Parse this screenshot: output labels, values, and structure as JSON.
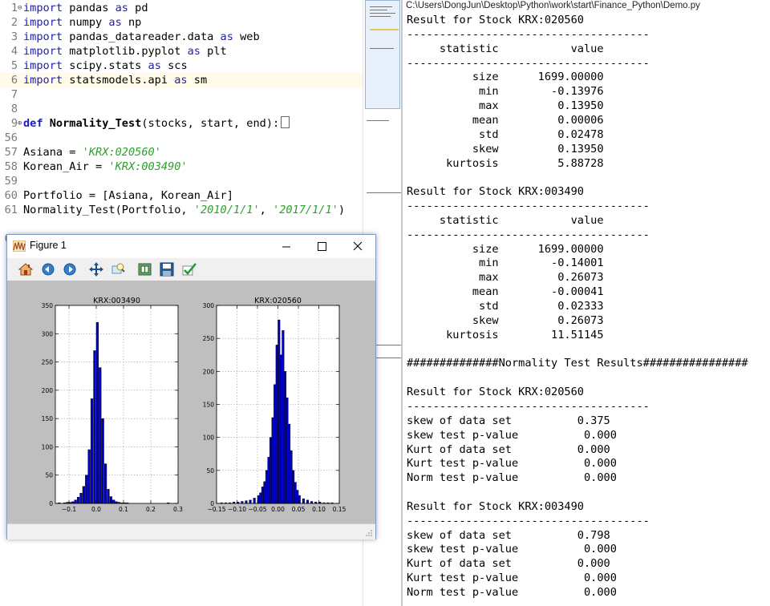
{
  "editor": {
    "lines": [
      {
        "num": "1",
        "fold": "⊖",
        "tokens": [
          {
            "t": "import",
            "c": "kw"
          },
          {
            "t": " pandas ",
            "c": "txt"
          },
          {
            "t": "as",
            "c": "kw"
          },
          {
            "t": " pd",
            "c": "txt"
          }
        ]
      },
      {
        "num": "2",
        "fold": "",
        "tokens": [
          {
            "t": "import",
            "c": "kw"
          },
          {
            "t": " numpy ",
            "c": "txt"
          },
          {
            "t": "as",
            "c": "kw"
          },
          {
            "t": " np",
            "c": "txt"
          }
        ]
      },
      {
        "num": "3",
        "fold": "",
        "tokens": [
          {
            "t": "import",
            "c": "kw"
          },
          {
            "t": " pandas_datareader.data ",
            "c": "txt"
          },
          {
            "t": "as",
            "c": "kw"
          },
          {
            "t": " web",
            "c": "txt"
          }
        ]
      },
      {
        "num": "4",
        "fold": "",
        "tokens": [
          {
            "t": "import",
            "c": "kw"
          },
          {
            "t": " matplotlib.pyplot ",
            "c": "txt"
          },
          {
            "t": "as",
            "c": "kw"
          },
          {
            "t": " plt",
            "c": "txt"
          }
        ]
      },
      {
        "num": "5",
        "fold": "",
        "tokens": [
          {
            "t": "import",
            "c": "kw"
          },
          {
            "t": " scipy.stats ",
            "c": "txt"
          },
          {
            "t": "as",
            "c": "kw"
          },
          {
            "t": " scs",
            "c": "txt"
          }
        ]
      },
      {
        "num": "6",
        "fold": "",
        "tokens": [
          {
            "t": "import",
            "c": "kw"
          },
          {
            "t": " statsmodels.api ",
            "c": "txt"
          },
          {
            "t": "as",
            "c": "kw"
          },
          {
            "t": " sm",
            "c": "txt"
          }
        ]
      },
      {
        "num": "7",
        "fold": "",
        "tokens": []
      },
      {
        "num": "8",
        "fold": "",
        "tokens": []
      },
      {
        "num": "9",
        "fold": "⊕",
        "tokens": [
          {
            "t": "def",
            "c": "kwb"
          },
          {
            "t": " ",
            "c": "txt"
          },
          {
            "t": "Normality_Test",
            "c": "fn"
          },
          {
            "t": "(stocks, start, end):",
            "c": "txt"
          }
        ],
        "collapsed": true
      },
      {
        "num": "56",
        "fold": "",
        "tokens": []
      },
      {
        "num": "57",
        "fold": "",
        "tokens": [
          {
            "t": "Asiana = ",
            "c": "txt"
          },
          {
            "t": "'KRX:020560'",
            "c": "str"
          }
        ]
      },
      {
        "num": "58",
        "fold": "",
        "tokens": [
          {
            "t": "Korean_Air = ",
            "c": "txt"
          },
          {
            "t": "'KRX:003490'",
            "c": "str"
          }
        ]
      },
      {
        "num": "59",
        "fold": "",
        "tokens": []
      },
      {
        "num": "60",
        "fold": "",
        "tokens": [
          {
            "t": "Portfolio = [Asiana, Korean_Air]",
            "c": "txt"
          }
        ]
      },
      {
        "num": "61",
        "fold": "",
        "tokens": [
          {
            "t": "Normality_Test(Portfolio, ",
            "c": "txt"
          },
          {
            "t": "'2010/1/1'",
            "c": "str"
          },
          {
            "t": ", ",
            "c": "txt"
          },
          {
            "t": "'2017/1/1'",
            "c": "str"
          },
          {
            "t": ")",
            "c": "txt"
          }
        ]
      },
      {
        "num": "62",
        "fold": "",
        "tokens": []
      }
    ]
  },
  "console": {
    "path": "C:\\Users\\DongJun\\Desktop\\Python\\work\\start\\Finance_Python\\Demo.py",
    "lines": [
      "Result for Stock KRX:020560",
      "-------------------------------------",
      "     statistic           value",
      "-------------------------------------",
      "          size      1699.00000",
      "           min        -0.13976",
      "           max         0.13950",
      "          mean         0.00006",
      "           std         0.02478",
      "          skew         0.13950",
      "      kurtosis         5.88728",
      "",
      "Result for Stock KRX:003490",
      "-------------------------------------",
      "     statistic           value",
      "-------------------------------------",
      "          size      1699.00000",
      "           min        -0.14001",
      "           max         0.26073",
      "          mean        -0.00041",
      "           std         0.02333",
      "          skew         0.26073",
      "      kurtosis        11.51145",
      "",
      "##############Normality Test Results################",
      "",
      "Result for Stock KRX:020560",
      "-------------------------------------",
      "skew of data set          0.375",
      "skew test p-value          0.000",
      "Kurt of data set          0.000",
      "Kurt test p-value          0.000",
      "Norm test p-value          0.000",
      "",
      "Result for Stock KRX:003490",
      "-------------------------------------",
      "skew of data set          0.798",
      "skew test p-value          0.000",
      "Kurt of data set          0.000",
      "Kurt test p-value          0.000",
      "Norm test p-value          0.000"
    ]
  },
  "figure": {
    "title": "Figure 1",
    "toolbar": [
      "home-icon",
      "back-icon",
      "forward-icon",
      "pan-icon",
      "zoom-icon",
      "subplots-icon",
      "save-icon",
      "edit-icon"
    ]
  },
  "colors": {
    "bar_fill": "#0000cc",
    "bar_edge": "#000000",
    "canvas_bg": "#bfbfbf",
    "string": "#2ea12e",
    "keyword": "#1a1ac8"
  },
  "chart_data": [
    {
      "type": "bar",
      "title": "KRX:003490",
      "xlim": [
        -0.15,
        0.3
      ],
      "ylim": [
        0,
        350
      ],
      "xticks": [
        -0.1,
        0.0,
        0.1,
        0.2,
        0.3
      ],
      "xtick_labels": [
        "−0.1",
        "0.0",
        "0.1",
        "0.2",
        "0.3"
      ],
      "yticks": [
        0,
        50,
        100,
        150,
        200,
        250,
        300,
        350
      ],
      "grid": true,
      "bins": [
        -0.14,
        -0.13,
        -0.12,
        -0.11,
        -0.1,
        -0.09,
        -0.08,
        -0.07,
        -0.06,
        -0.05,
        -0.04,
        -0.03,
        -0.02,
        -0.01,
        0.0,
        0.01,
        0.02,
        0.03,
        0.04,
        0.05,
        0.06,
        0.07,
        0.08,
        0.09,
        0.1,
        0.11,
        0.12,
        0.13,
        0.14,
        0.15,
        0.16,
        0.17,
        0.18,
        0.19,
        0.2,
        0.21,
        0.22,
        0.23,
        0.24,
        0.25,
        0.26
      ],
      "bin_width": 0.008,
      "values": [
        1,
        0,
        1,
        2,
        2,
        3,
        6,
        11,
        18,
        30,
        50,
        95,
        185,
        270,
        320,
        240,
        150,
        70,
        25,
        12,
        6,
        3,
        2,
        1,
        1,
        1,
        0,
        0,
        0,
        0,
        0,
        0,
        0,
        0,
        0,
        0,
        0,
        0,
        0,
        0,
        1
      ]
    },
    {
      "type": "bar",
      "title": "KRX:020560",
      "xlim": [
        -0.15,
        0.15
      ],
      "ylim": [
        0,
        300
      ],
      "xticks": [
        -0.15,
        -0.1,
        -0.05,
        0.0,
        0.05,
        0.1,
        0.15
      ],
      "xtick_labels": [
        "−0.15",
        "−0.10",
        "−0.05",
        "0.00",
        "0.05",
        "0.10",
        "0.15"
      ],
      "yticks": [
        0,
        50,
        100,
        150,
        200,
        250,
        300
      ],
      "grid": true,
      "bins": [
        -0.14,
        -0.13,
        -0.12,
        -0.11,
        -0.1,
        -0.09,
        -0.08,
        -0.07,
        -0.06,
        -0.05,
        -0.045,
        -0.04,
        -0.035,
        -0.03,
        -0.025,
        -0.02,
        -0.015,
        -0.01,
        -0.005,
        0.0,
        0.005,
        0.01,
        0.015,
        0.02,
        0.025,
        0.03,
        0.035,
        0.04,
        0.045,
        0.05,
        0.06,
        0.07,
        0.08,
        0.09,
        0.1,
        0.11,
        0.12,
        0.13
      ],
      "bin_width": 0.005,
      "values": [
        1,
        1,
        1,
        2,
        2,
        3,
        4,
        5,
        8,
        12,
        16,
        25,
        33,
        50,
        70,
        100,
        130,
        180,
        240,
        278,
        225,
        262,
        200,
        160,
        120,
        80,
        50,
        32,
        20,
        12,
        7,
        5,
        3,
        2,
        2,
        1,
        1,
        1
      ]
    }
  ]
}
